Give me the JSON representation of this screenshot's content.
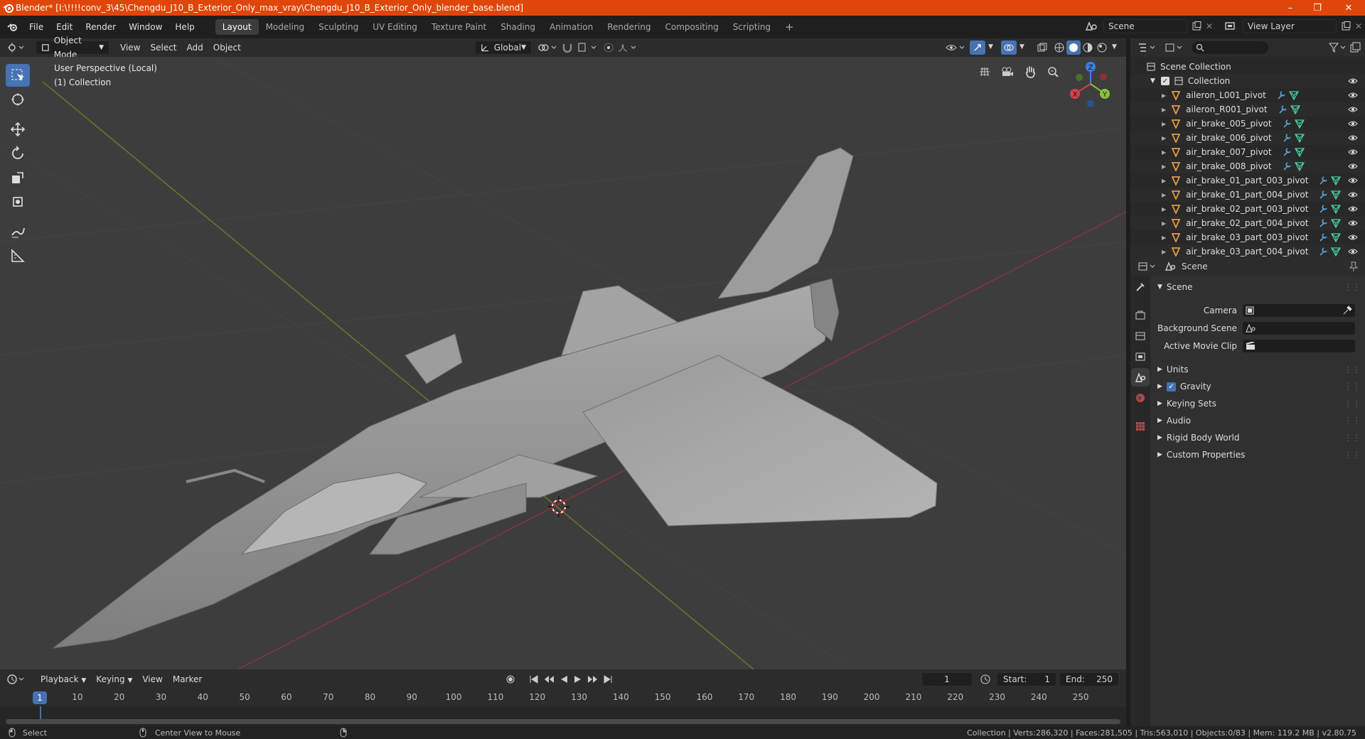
{
  "window": {
    "title": "Blender* [I:\\!!!!conv_3\\45\\Chengdu_J10_B_Exterior_Only_max_vray\\Chengdu_J10_B_Exterior_Only_blender_base.blend]",
    "controls": {
      "minimize": "–",
      "maximize": "❐",
      "close": "✕"
    }
  },
  "menubar": {
    "menus": [
      "File",
      "Edit",
      "Render",
      "Window",
      "Help"
    ],
    "workspaces": [
      "Layout",
      "Modeling",
      "Sculpting",
      "UV Editing",
      "Texture Paint",
      "Shading",
      "Animation",
      "Rendering",
      "Compositing",
      "Scripting"
    ],
    "active_workspace": "Layout",
    "add_tab": "+",
    "scene": "Scene",
    "view_layer": "View Layer"
  },
  "viewport_header": {
    "mode": "Object Mode",
    "menus": [
      "View",
      "Select",
      "Add",
      "Object"
    ],
    "transform_orientation": "Global"
  },
  "viewport": {
    "perspective_label": "User Perspective (Local)",
    "collection_label": "(1) Collection",
    "gizmo": {
      "x": "X",
      "y": "Y",
      "z": "Z"
    }
  },
  "timeline": {
    "menus": [
      "Playback",
      "Keying",
      "View",
      "Marker"
    ],
    "current_frame": "1",
    "start_label": "Start:",
    "start": "1",
    "end_label": "End:",
    "end": "250",
    "ruler_ticks": [
      "1",
      "10",
      "20",
      "30",
      "40",
      "50",
      "60",
      "70",
      "80",
      "90",
      "100",
      "110",
      "120",
      "130",
      "140",
      "150",
      "160",
      "170",
      "180",
      "190",
      "200",
      "210",
      "220",
      "230",
      "240",
      "250"
    ]
  },
  "outliner": {
    "root": "Scene Collection",
    "collection": "Collection",
    "items": [
      "aileron_L001_pivot",
      "aileron_R001_pivot",
      "air_brake_005_pivot",
      "air_brake_006_pivot",
      "air_brake_007_pivot",
      "air_brake_008_pivot",
      "air_brake_01_part_003_pivot",
      "air_brake_01_part_004_pivot",
      "air_brake_02_part_003_pivot",
      "air_brake_02_part_004_pivot",
      "air_brake_03_part_003_pivot",
      "air_brake_03_part_004_pivot"
    ]
  },
  "properties": {
    "context": "Scene",
    "panel_title": "Scene",
    "fields": [
      {
        "label": "Camera"
      },
      {
        "label": "Background Scene"
      },
      {
        "label": "Active Movie Clip"
      }
    ],
    "sections": [
      "Units",
      "Gravity",
      "Keying Sets",
      "Audio",
      "Rigid Body World",
      "Custom Properties"
    ]
  },
  "statusbar": {
    "left_action": "Select",
    "middle_action": "Center View to Mouse",
    "stats": "Collection | Verts:286,320 | Faces:281,505 | Tris:563,010 | Objects:0/83 | Mem: 119.2 MB | v2.80.75"
  },
  "colors": {
    "titlebar": "#e0460a",
    "active_blue": "#4772b3",
    "x_axis": "#d93f4c",
    "y_axis": "#8ac23a",
    "z_axis": "#3b7ee6",
    "frame_marker": "#4772b3"
  }
}
